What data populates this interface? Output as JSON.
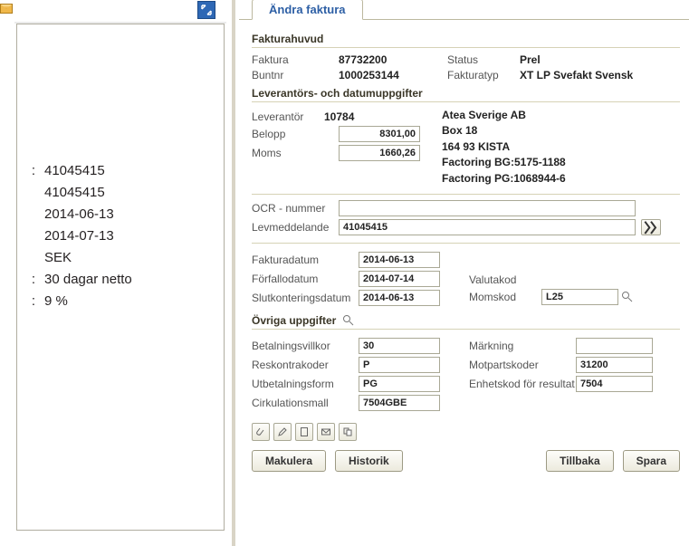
{
  "tab": {
    "title": "Ändra faktura"
  },
  "left_doc": {
    "rows": [
      {
        "colon": ":",
        "value": "41045415"
      },
      {
        "colon": "",
        "value": "41045415"
      },
      {
        "colon": "",
        "value": "2014-06-13"
      },
      {
        "colon": "",
        "value": "2014-07-13"
      },
      {
        "colon": "",
        "value": "SEK"
      },
      {
        "colon": ":",
        "value": "30 dagar netto"
      },
      {
        "colon": ":",
        "value": "9        %"
      }
    ]
  },
  "sections": {
    "fakturahuvud": "Fakturahuvud",
    "leverantor": "Leverantörs- och datumuppgifter",
    "ovriga": "Övriga uppgifter"
  },
  "head": {
    "faktura_lbl": "Faktura",
    "faktura": "87732200",
    "status_lbl": "Status",
    "status": "Prel",
    "buntnr_lbl": "Buntnr",
    "buntnr": "1000253144",
    "fakturatyp_lbl": "Fakturatyp",
    "fakturatyp": "XT LP Svefakt Svensk"
  },
  "supplier": {
    "leverantor_lbl": "Leverantör",
    "leverantor": "10784",
    "belopp_lbl": "Belopp",
    "belopp": "8301,00",
    "moms_lbl": "Moms",
    "moms": "1660,26",
    "name": "Atea Sverige AB",
    "addr1": "Box 18",
    "addr2": "164 93 KISTA",
    "bg": "Factoring BG:5175-1188",
    "pg": "Factoring PG:1068944-6"
  },
  "mid": {
    "ocr_lbl": "OCR - nummer",
    "ocr": "",
    "lev_lbl": "Levmeddelande",
    "lev": "41045415",
    "fakturadatum_lbl": "Fakturadatum",
    "fakturadatum": "2014-06-13",
    "forfallodatum_lbl": "Förfallodatum",
    "forfallodatum": "2014-07-14",
    "slutkont_lbl": "Slutkonteringsdatum",
    "slutkont": "2014-06-13",
    "valutakod_lbl": "Valutakod",
    "momskod_lbl": "Momskod",
    "momskod": "L25"
  },
  "other": {
    "betvillkor_lbl": "Betalningsvillkor",
    "betvillkor": "30",
    "markning_lbl": "Märkning",
    "markning": "",
    "reskontra_lbl": "Reskontrakoder",
    "reskontra": "P",
    "motparts_lbl": "Motpartskoder",
    "motparts": "31200",
    "utbet_lbl": "Utbetalningsform",
    "utbet": "PG",
    "enhet_lbl": "Enhetskod för resultat",
    "enhet": "7504",
    "cirk_lbl": "Cirkulationsmall",
    "cirk": "7504GBE"
  },
  "buttons": {
    "makulera": "Makulera",
    "historik": "Historik",
    "tillbaka": "Tillbaka",
    "spara": "Spara"
  }
}
